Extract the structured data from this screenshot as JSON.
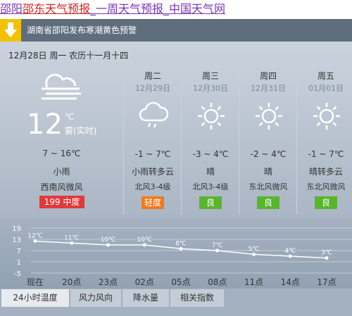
{
  "title": {
    "part1": "邵阳",
    "part2": "邵东天气预报",
    "part3": "_一周天气预报_中国天气网"
  },
  "alert": {
    "text": "湖南省邵阳发布寒潮黄色预警",
    "icon": "cold-wave-warning-icon",
    "color": "#f2c200"
  },
  "today": {
    "date_line": "12月28日 周一 农历十一月十四",
    "temp": "12",
    "unit": "℃",
    "label": "雾(实时)",
    "range": "7 ~ 16℃",
    "weather": "小雨",
    "wind": "西南风微风",
    "aqi": "199 中度",
    "aqi_color": "#e03a3a",
    "icon": "fog-icon"
  },
  "days": [
    {
      "name": "周二",
      "date": "12月29日",
      "range": "-1 ~ 7℃",
      "weather": "小雨转多云",
      "wind": "北风3-4级",
      "aqi": "轻度",
      "aqi_color": "#f07a1a",
      "icon": "rain-cloud-icon"
    },
    {
      "name": "周三",
      "date": "12月30日",
      "range": "-3 ~ 4℃",
      "weather": "晴",
      "wind": "北风3-4级",
      "aqi": "良",
      "aqi_color": "#58b52c",
      "icon": "sun-icon"
    },
    {
      "name": "周四",
      "date": "12月31日",
      "range": "-2 ~ 4℃",
      "weather": "晴",
      "wind": "东北风微风",
      "aqi": "良",
      "aqi_color": "#58b52c",
      "icon": "sun-icon"
    },
    {
      "name": "周五",
      "date": "01月01日",
      "range": "-1 ~ 7℃",
      "weather": "晴转多云",
      "wind": "东北风微风",
      "aqi": "良",
      "aqi_color": "#58b52c",
      "icon": "sun-icon"
    }
  ],
  "chart_data": {
    "type": "line",
    "categories": [
      "现在",
      "20点",
      "23点",
      "02点",
      "05点",
      "08点",
      "11点",
      "14点",
      "17点"
    ],
    "values": [
      12,
      11,
      10,
      10,
      8,
      7,
      5,
      4,
      3
    ],
    "point_labels": [
      "12℃",
      "11℃",
      "10℃",
      "10℃",
      "8℃",
      "7℃",
      "5℃",
      "4℃",
      "3℃"
    ],
    "yticks": [
      19,
      13,
      7,
      1,
      -5
    ],
    "ylim": [
      -5,
      19
    ],
    "grid": true
  },
  "tabs": [
    "24小时温度",
    "风力风向",
    "降水量",
    "相关指数"
  ]
}
